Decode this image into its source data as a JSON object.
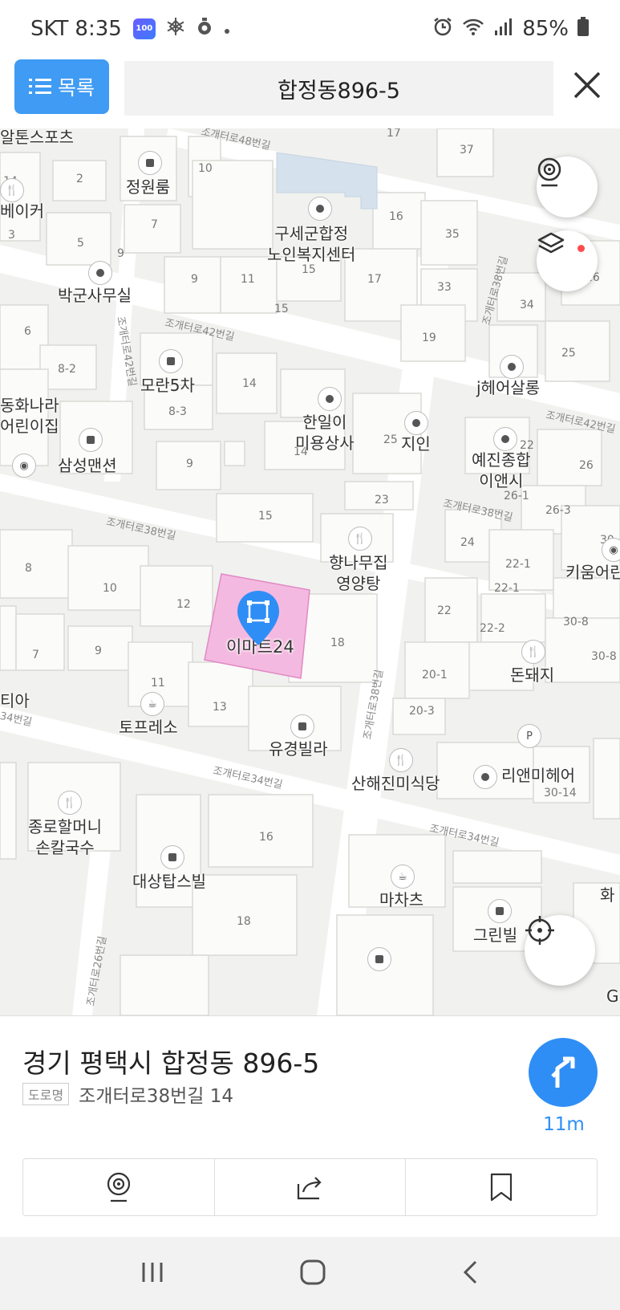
{
  "status_bar": {
    "carrier": "SKT",
    "time": "8:35",
    "battery": "85%",
    "icons": [
      "app-badge-icon",
      "snowflake-icon",
      "ring-icon",
      "dot-icon",
      "alarm-icon",
      "wifi-icon",
      "signal-icon",
      "battery-icon"
    ]
  },
  "header": {
    "list_button_label": "목록",
    "search_value": "합정동896-5"
  },
  "map": {
    "place_labels": {
      "jeongwonroom": "정원룸",
      "baker": "베이커",
      "guse": "구세군합정\n노인복지센터",
      "bakgunsa": "박군사무실",
      "moran": "모란5차",
      "hanil": "한일이\n미용상사",
      "jiin": "지인",
      "jhair": "j헤어살롱",
      "donghwa": "동화나라\n어린이집",
      "samsung": "삼성맨션",
      "yejin": "예진종합\n이앤시",
      "hyangnamu": "향나무집\n영양탕",
      "kium": "키움어린",
      "emart": "이마트24",
      "dondaeji": "돈돼지",
      "tofresso": "토프레소",
      "yugyeong": "유경빌라",
      "sanhae": "산해진미식당",
      "lian": "리앤미헤어",
      "jongro": "종로할머니\n손칼국수",
      "daemyeong": "대상탑스빌",
      "machachu": "마차츠",
      "green": "그린빌",
      "sports": "알톤스포츠",
      "hwa": "화",
      "tia": "티아",
      "g": "G"
    },
    "road_labels": {
      "r48": "조개터로48번길",
      "r42a": "조개터로42번길",
      "r42b": "조개터로42번길",
      "r38a": "조개터로38번길",
      "r38b": "조개터로38번길",
      "r38c": "조개터로38번길",
      "r38v": "조개터로38번길",
      "r34a": "조개터로34번길",
      "r34b": "조개터로34번길",
      "r34c": "34번길",
      "r42v": "조개터로42번길",
      "r26": "조개터로26번길"
    },
    "lot_numbers": [
      "2",
      "10",
      "7",
      "5",
      "9",
      "11",
      "15",
      "17",
      "16",
      "35",
      "33",
      "19",
      "37",
      "34",
      "26",
      "25",
      "14",
      "8-2",
      "8-3",
      "6",
      "9",
      "14",
      "25",
      "22",
      "26",
      "26-1",
      "26-3",
      "23",
      "15",
      "24",
      "22-1",
      "22-1",
      "30-8",
      "22",
      "22-2",
      "30-8",
      "8",
      "10",
      "12",
      "18",
      "7",
      "9",
      "11",
      "13",
      "20-1",
      "20-3",
      "30-14",
      "16",
      "18",
      "3",
      "14",
      "17",
      "15",
      "9",
      "30"
    ]
  },
  "sheet": {
    "address": "경기 평택시 합정동 896-5",
    "road_tag": "도로명",
    "road_address": "조개터로38번길 14",
    "distance": "11m"
  },
  "colors": {
    "accent": "#2f8ef5",
    "list_button": "#3f9bf3",
    "selected_building": "#f3b8e0",
    "map_bg": "#f1f1ef",
    "building": "#fbfbf9",
    "building_stroke": "#d9d9d5"
  }
}
